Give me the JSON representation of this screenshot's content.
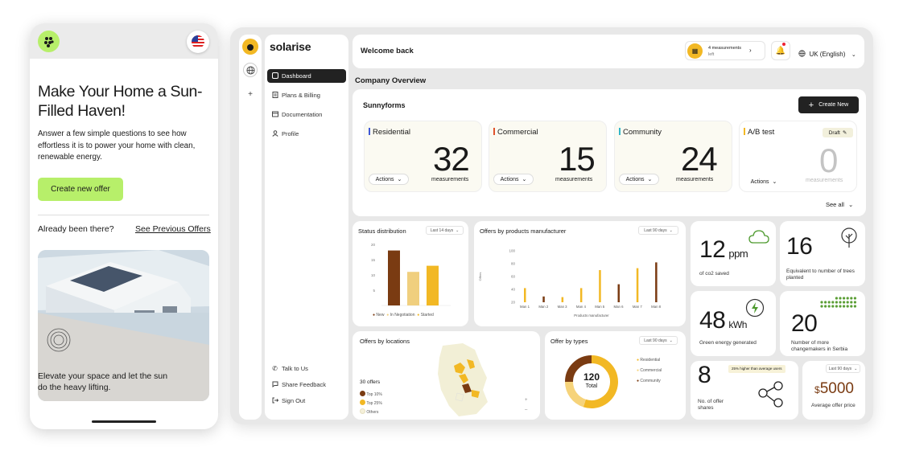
{
  "phone": {
    "title": "Make Your Home a Sun-Filled Haven!",
    "subtitle": "Answer a few simple questions to see how effortless it is to power your home with clean, renewable energy.",
    "cta": "Create new offer",
    "already": "Already been there?",
    "previous": "See Previous Offers",
    "card_text": "Elevate your space and let the sun do the heavy lifting."
  },
  "sidebar": {
    "brand": "solarise",
    "items": [
      {
        "label": "Dashboard",
        "icon": "dashboard-icon"
      },
      {
        "label": "Plans & Billing",
        "icon": "billing-icon"
      },
      {
        "label": "Documentation",
        "icon": "document-icon"
      },
      {
        "label": "Profile",
        "icon": "user-icon"
      }
    ],
    "bottom": [
      {
        "label": "Talk to Us",
        "icon": "phone-icon"
      },
      {
        "label": "Share Feedback",
        "icon": "chat-icon"
      },
      {
        "label": "Sign Out",
        "icon": "signout-icon"
      }
    ]
  },
  "header": {
    "welcome": "Welcome back",
    "measurements_line1": "4 measurements",
    "measurements_line2": "left",
    "language": "UK (English)"
  },
  "overview": {
    "title": "Company Overview",
    "section": "Sunnyforms",
    "create": "Create New",
    "see_all": "See all",
    "cards": [
      {
        "name": "Residential",
        "value": "32",
        "unit": "measurements",
        "action": "Actions",
        "color": "#4059d6"
      },
      {
        "name": "Commercial",
        "value": "15",
        "unit": "measurements",
        "action": "Actions",
        "color": "#e0532b"
      },
      {
        "name": "Community",
        "value": "24",
        "unit": "measurements",
        "action": "Actions",
        "color": "#34b6c9"
      },
      {
        "name": "A/B test",
        "value": "0",
        "unit": "measurements",
        "action": "Actions",
        "badge": "Draft",
        "color": "#f2b824"
      }
    ]
  },
  "status": {
    "title": "Status distribution",
    "range": "Last 14 days",
    "legend": [
      "New",
      "In Negotiation",
      "Started"
    ]
  },
  "manufacturer": {
    "title": "Offers by products manufacturer",
    "range": "Last 90 days",
    "ylabel": "Offers",
    "xlabel": "Products manufacturer",
    "ticks": [
      "100",
      "80",
      "60",
      "40",
      "20"
    ]
  },
  "chart_data": [
    {
      "type": "bar",
      "title": "Status distribution",
      "categories": [
        "New",
        "In Negotiation",
        "Started"
      ],
      "values": [
        18,
        11,
        13
      ],
      "ylim": [
        0,
        20
      ],
      "colors": [
        "#7a3b12",
        "#f0cf7e",
        "#f2b824"
      ]
    },
    {
      "type": "bar",
      "title": "Offers by products manufacturer",
      "xlabel": "Products manufacturer",
      "ylabel": "Offers",
      "categories": [
        "Man 1",
        "Man 2",
        "Man 3",
        "Man 4",
        "Man 5",
        "Man 6",
        "Man 7",
        "Man 8"
      ],
      "values": [
        42,
        29,
        28,
        42,
        70,
        48,
        73,
        82
      ],
      "colors": [
        "#f2b824",
        "#7a3b12",
        "#f2b824",
        "#f2b824",
        "#f2b824",
        "#7a3b12",
        "#f2b824",
        "#7a3b12"
      ],
      "ylim": [
        20,
        100
      ]
    },
    {
      "type": "pie",
      "title": "Offer by types",
      "categories": [
        "Residential",
        "Commercial",
        "Community"
      ],
      "values": [
        55,
        20,
        25
      ],
      "colors": [
        "#f2b824",
        "#f6d37a",
        "#7a3b12"
      ]
    }
  ],
  "locations": {
    "title": "Offers by locations",
    "count": "30 offers",
    "legend": [
      {
        "label": "Top 10%",
        "color": "#7a3b12"
      },
      {
        "label": "Top 25%",
        "color": "#f2b824"
      },
      {
        "label": "Others",
        "color": "#f5f0da"
      }
    ]
  },
  "types": {
    "title": "Offer by types",
    "range": "Last 90 days",
    "center_value": "120",
    "center_label": "Total",
    "legend": [
      "Residential",
      "Commercial",
      "Community"
    ]
  },
  "metrics": {
    "co2": {
      "value": "12",
      "unit": "ppm",
      "label": "of co2 saved"
    },
    "trees": {
      "value": "16",
      "label": "Equivalent to number of trees planted"
    },
    "energy": {
      "value": "48",
      "unit": "kWh",
      "label": "Green energy generated"
    },
    "changemakers": {
      "value": "20",
      "label": "Number of more changemakers in Serbia"
    },
    "shares": {
      "value": "8",
      "label": "No. of offer shares",
      "badge": "25% higher than average users"
    },
    "price": {
      "prefix": "$",
      "value": "5000",
      "label": "Average offer price",
      "range": "Last 90 days"
    }
  }
}
